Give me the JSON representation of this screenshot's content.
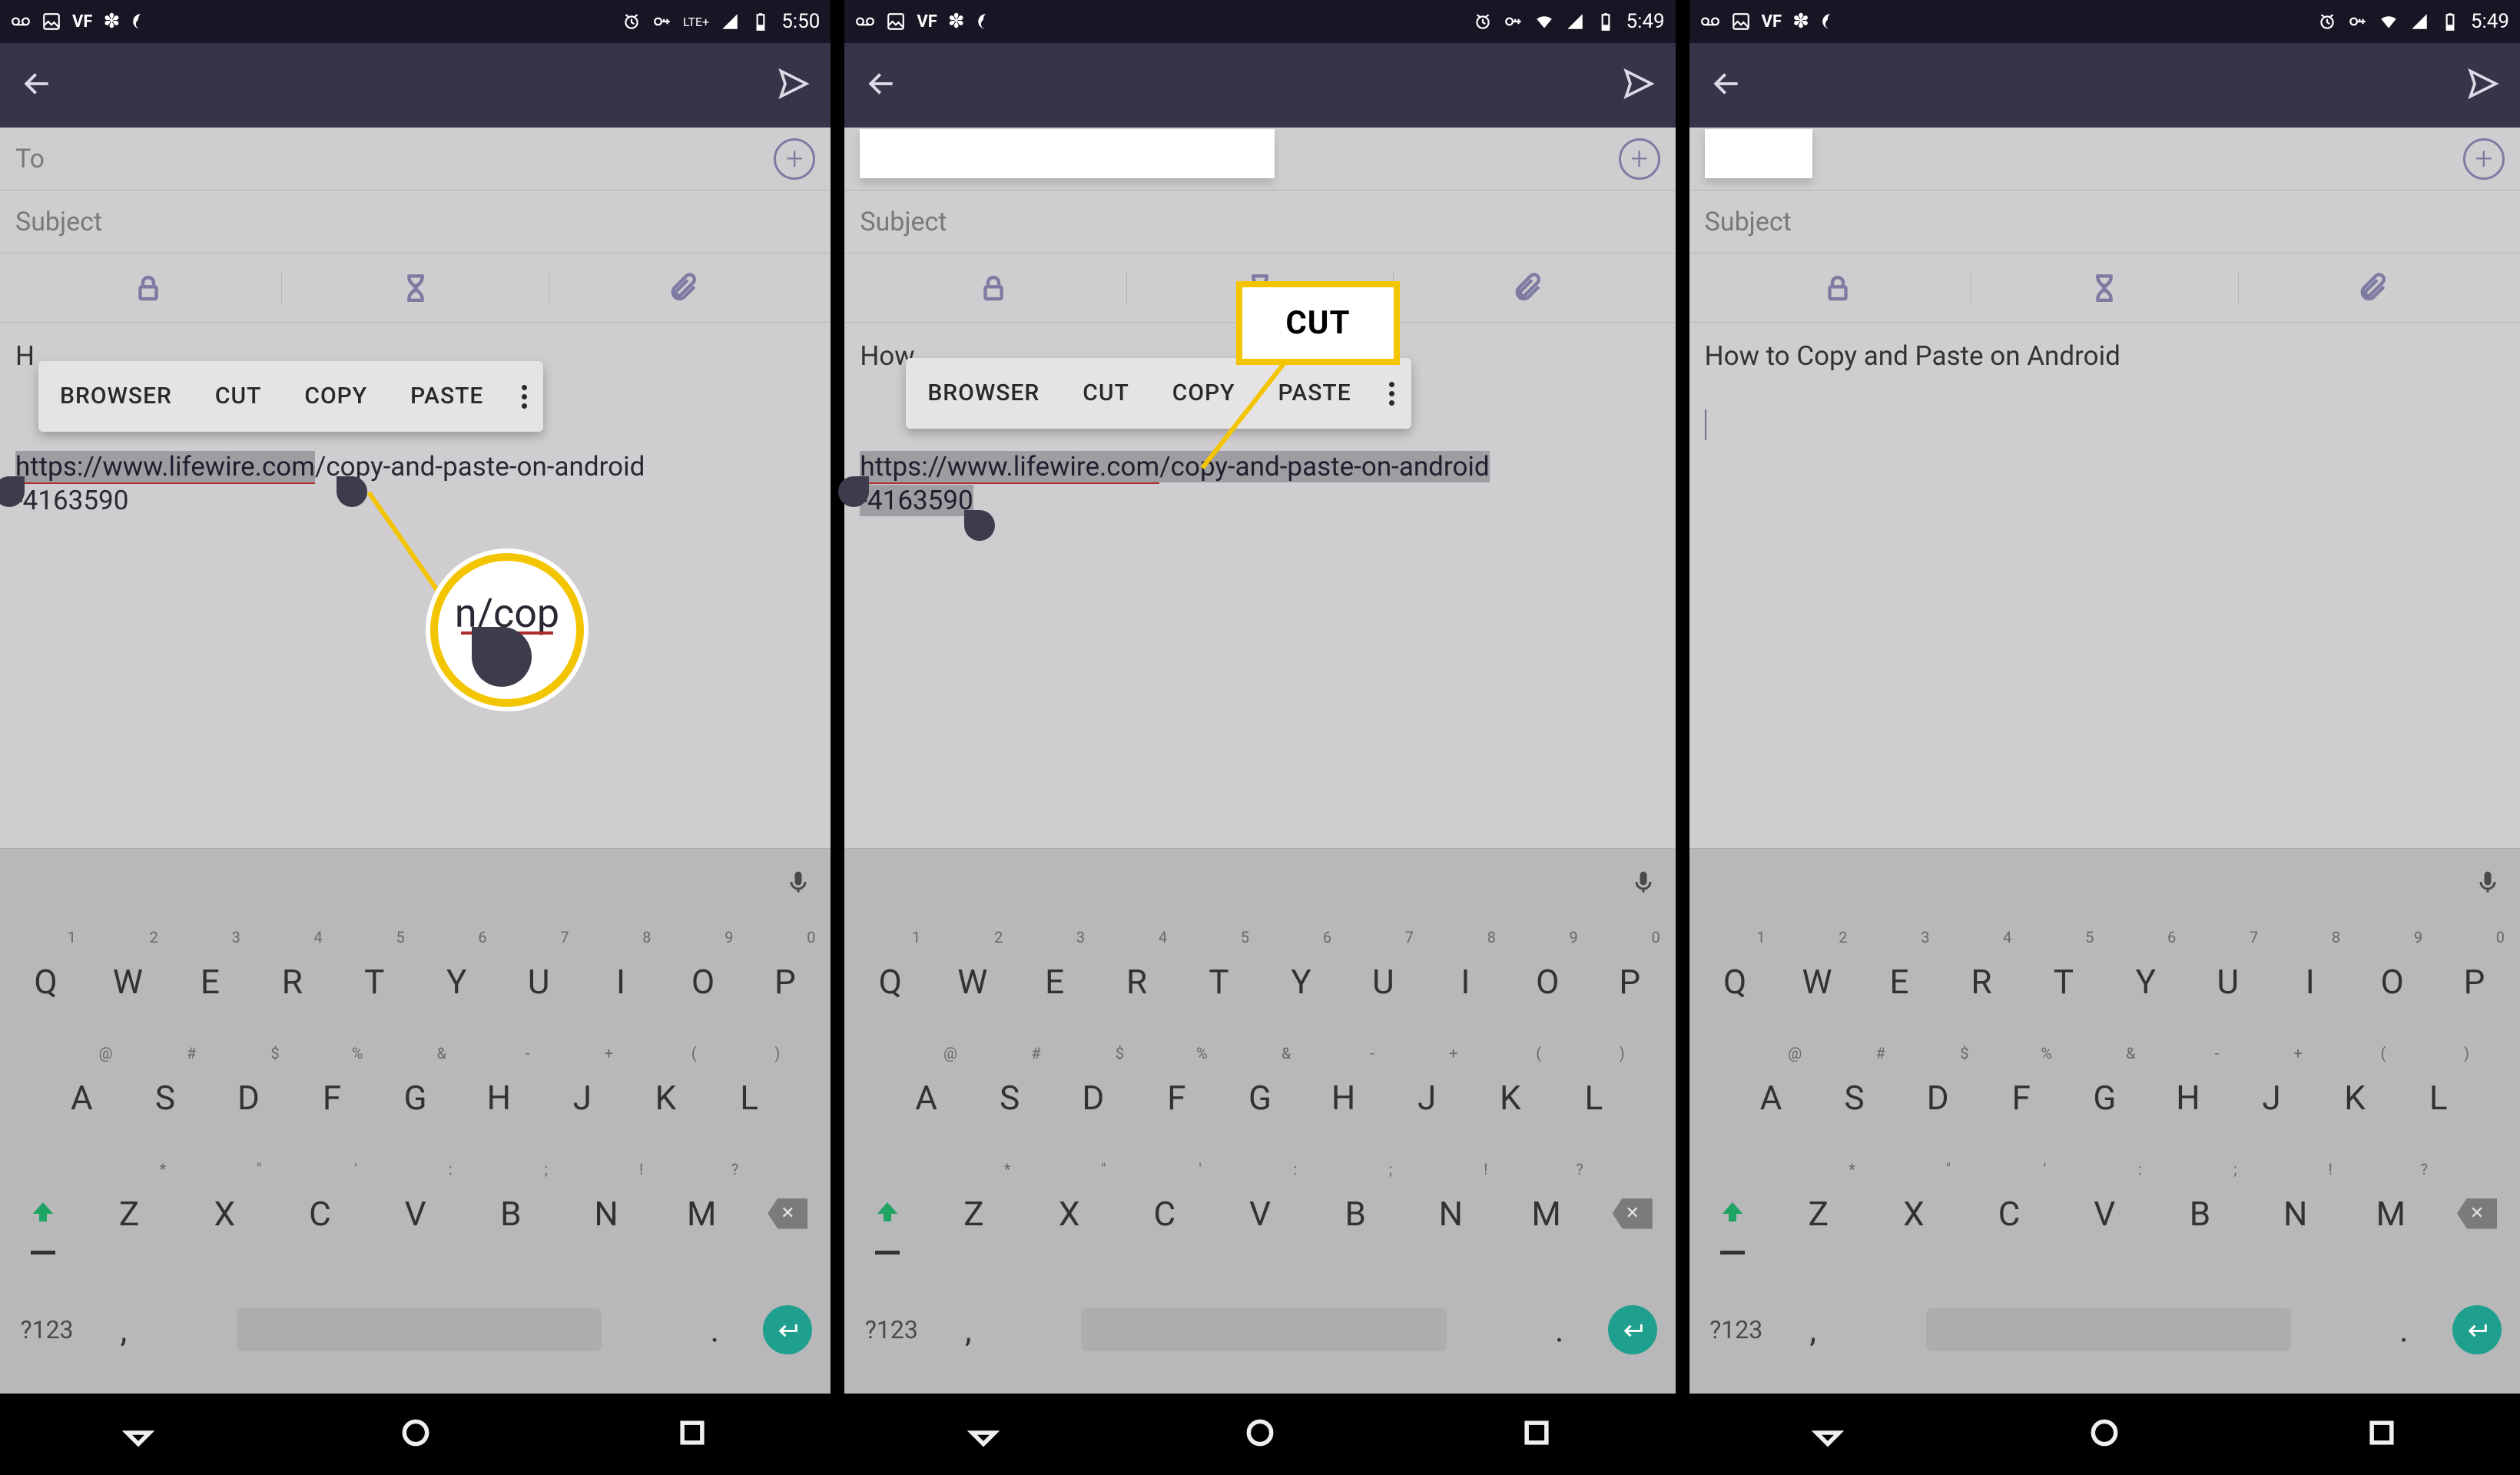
{
  "status": {
    "time1": "5:50",
    "time2": "5:49",
    "time3": "5:49",
    "net": "LTE+"
  },
  "compose": {
    "to": "To",
    "subject": "Subject"
  },
  "ctx": {
    "browser": "BROWSER",
    "cut": "CUT",
    "copy": "COPY",
    "paste": "PASTE"
  },
  "screen1": {
    "bodyPrefix": "H",
    "urlA": "https://www.lifewire.com",
    "urlB": "/copy-and-paste-on-android",
    "urlC": "-4163590",
    "magText": "n/cop"
  },
  "screen2": {
    "bodyPrefix": "How",
    "urlA": "https://www.lifewire.com",
    "urlB": "/copy-and-paste-on-android",
    "urlC": "-4163590",
    "calloutLabel": "CUT"
  },
  "screen3": {
    "bodyLine1": "How to Copy and Paste on Android"
  },
  "kbd": {
    "r1": [
      [
        "Q",
        "1"
      ],
      [
        "W",
        "2"
      ],
      [
        "E",
        "3"
      ],
      [
        "R",
        "4"
      ],
      [
        "T",
        "5"
      ],
      [
        "Y",
        "6"
      ],
      [
        "U",
        "7"
      ],
      [
        "I",
        "8"
      ],
      [
        "O",
        "9"
      ],
      [
        "P",
        "0"
      ]
    ],
    "r2": [
      [
        "A",
        "@"
      ],
      [
        "S",
        "#"
      ],
      [
        "D",
        "$"
      ],
      [
        "F",
        "%"
      ],
      [
        "G",
        "&"
      ],
      [
        "H",
        "-"
      ],
      [
        "J",
        "+"
      ],
      [
        "K",
        "("
      ],
      [
        "L",
        ")"
      ]
    ],
    "r3": [
      [
        "Z",
        "*"
      ],
      [
        "X",
        "\""
      ],
      [
        "C",
        "'"
      ],
      [
        "V",
        ":"
      ],
      [
        "B",
        ";"
      ],
      [
        "N",
        "!"
      ],
      [
        "M",
        "?"
      ]
    ],
    "sym": "?123",
    "comma": ",",
    "period": "."
  }
}
